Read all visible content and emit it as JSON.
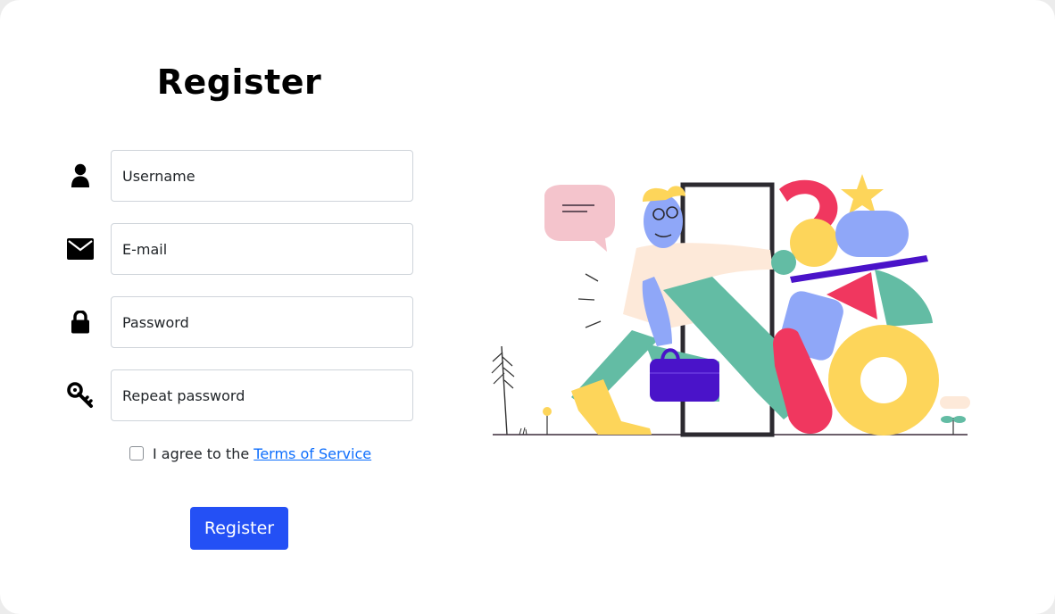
{
  "form": {
    "title": "Register",
    "fields": [
      {
        "icon": "user-icon",
        "placeholder": "Username",
        "type": "text"
      },
      {
        "icon": "envelope-icon",
        "placeholder": "E-mail",
        "type": "email"
      },
      {
        "icon": "lock-icon",
        "placeholder": "Password",
        "type": "password"
      },
      {
        "icon": "key-icon",
        "placeholder": "Repeat password",
        "type": "password"
      }
    ],
    "agree_prefix": "I agree to the ",
    "terms_link": "Terms of Service",
    "submit_label": "Register"
  },
  "colors": {
    "accent": "#2450f5",
    "link": "#0d6efd",
    "pink": "#f0375f",
    "yellow": "#fdd55a",
    "green": "#63bca4",
    "blue": "#8fa7f8",
    "purple": "#4a13c9",
    "skin": "#fde9d9"
  },
  "illustration": {
    "description_icon": "person-walking-through-door-illustration"
  }
}
